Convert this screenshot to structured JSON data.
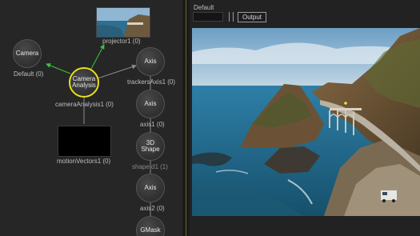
{
  "node_graph": {
    "nodes": {
      "camera": {
        "title": "Camera",
        "label": "Default (0)"
      },
      "camera_analysis": {
        "title_line1": "Camera",
        "title_line2": "Analysis",
        "label": "cameraAnalysis1 (0)"
      },
      "projector": {
        "label": "projector1 (0)"
      },
      "axis_trackers": {
        "title": "Axis",
        "label": "trackersAxis1 (0)"
      },
      "axis_1": {
        "title": "Axis",
        "label": "axis1 (0)"
      },
      "shape_3d": {
        "title_line1": "3D",
        "title_line2": "Shape",
        "label": "shapeId1 (1)"
      },
      "axis_2": {
        "title": "Axis",
        "label": "axis2 (0)"
      },
      "gmask": {
        "title": "GMask"
      },
      "motion_vectors": {
        "label": "motionVectors1 (0)"
      }
    },
    "colors": {
      "selected_ring": "#e8e01a",
      "flow_arrow": "#3ec43e",
      "wire": "#8a8a8a"
    }
  },
  "viewer": {
    "title": "Default",
    "output_button": "Output",
    "image": "coastal-bridge-highway-aerial"
  }
}
